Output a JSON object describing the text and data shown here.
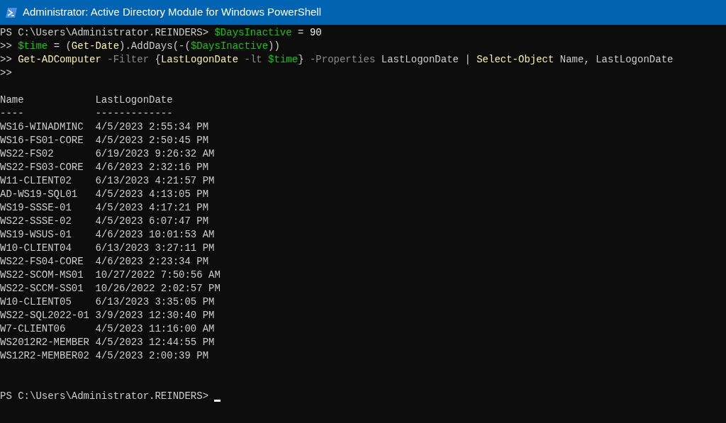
{
  "window": {
    "title": "Administrator: Active Directory Module for Windows PowerShell"
  },
  "command_lines": [
    {
      "segments": [
        {
          "kind": "plain",
          "text": "PS C:\\Users\\Administrator.REINDERS> "
        },
        {
          "kind": "variable",
          "text": "$DaysInactive"
        },
        {
          "kind": "operator",
          "text": " = "
        },
        {
          "kind": "number",
          "text": "90"
        }
      ]
    },
    {
      "segments": [
        {
          "kind": "plain",
          "text": ">> "
        },
        {
          "kind": "variable",
          "text": "$time"
        },
        {
          "kind": "plain",
          "text": " = ("
        },
        {
          "kind": "command",
          "text": "Get-Date"
        },
        {
          "kind": "plain",
          "text": ").AddDays(-("
        },
        {
          "kind": "variable",
          "text": "$DaysInactive"
        },
        {
          "kind": "plain",
          "text": "))"
        }
      ]
    },
    {
      "segments": [
        {
          "kind": "plain",
          "text": ">> "
        },
        {
          "kind": "command",
          "text": "Get-ADComputer"
        },
        {
          "kind": "parameter",
          "text": " -Filter "
        },
        {
          "kind": "plain",
          "text": "{"
        },
        {
          "kind": "command",
          "text": "LastLogonDate"
        },
        {
          "kind": "parameter",
          "text": " -lt "
        },
        {
          "kind": "variable",
          "text": "$time"
        },
        {
          "kind": "plain",
          "text": "}"
        },
        {
          "kind": "parameter",
          "text": " -Properties"
        },
        {
          "kind": "plain",
          "text": " LastLogonDate | "
        },
        {
          "kind": "command",
          "text": "Select-Object"
        },
        {
          "kind": "plain",
          "text": " Name, LastLogonDate"
        }
      ]
    },
    {
      "segments": [
        {
          "kind": "plain",
          "text": ">>"
        }
      ]
    }
  ],
  "output_table": {
    "columns": [
      "Name",
      "LastLogonDate"
    ],
    "underlines": [
      "----",
      "-------------"
    ],
    "rows": [
      {
        "name": "WS16-WINADMINC",
        "last_logon": "4/5/2023 2:55:34 PM"
      },
      {
        "name": "WS16-FS01-CORE",
        "last_logon": "4/5/2023 2:50:45 PM"
      },
      {
        "name": "WS22-FS02",
        "last_logon": "6/19/2023 9:26:32 AM"
      },
      {
        "name": "WS22-FS03-CORE",
        "last_logon": "4/6/2023 2:32:16 PM"
      },
      {
        "name": "W11-CLIENT02",
        "last_logon": "6/13/2023 4:21:57 PM"
      },
      {
        "name": "AD-WS19-SQL01",
        "last_logon": "4/5/2023 4:13:05 PM"
      },
      {
        "name": "WS19-SSSE-01",
        "last_logon": "4/5/2023 4:17:21 PM"
      },
      {
        "name": "WS22-SSSE-02",
        "last_logon": "4/5/2023 6:07:47 PM"
      },
      {
        "name": "WS19-WSUS-01",
        "last_logon": "4/6/2023 10:01:53 AM"
      },
      {
        "name": "W10-CLIENT04",
        "last_logon": "6/13/2023 3:27:11 PM"
      },
      {
        "name": "WS22-FS04-CORE",
        "last_logon": "4/6/2023 2:23:34 PM"
      },
      {
        "name": "WS22-SCOM-MS01",
        "last_logon": "10/27/2022 7:50:56 AM"
      },
      {
        "name": "WS22-SCCM-SS01",
        "last_logon": "10/26/2022 2:02:57 PM"
      },
      {
        "name": "W10-CLIENT05",
        "last_logon": "6/13/2023 3:35:05 PM"
      },
      {
        "name": "WS22-SQL2022-01",
        "last_logon": "3/9/2023 12:30:40 PM"
      },
      {
        "name": "W7-CLIENT06",
        "last_logon": "4/5/2023 11:16:00 AM"
      },
      {
        "name": "WS2012R2-MEMBER",
        "last_logon": "4/5/2023 12:44:55 PM"
      },
      {
        "name": "WS12R2-MEMBER02",
        "last_logon": "4/5/2023 2:00:39 PM"
      }
    ]
  },
  "final_prompt": {
    "text": "PS C:\\Users\\Administrator.REINDERS> "
  }
}
